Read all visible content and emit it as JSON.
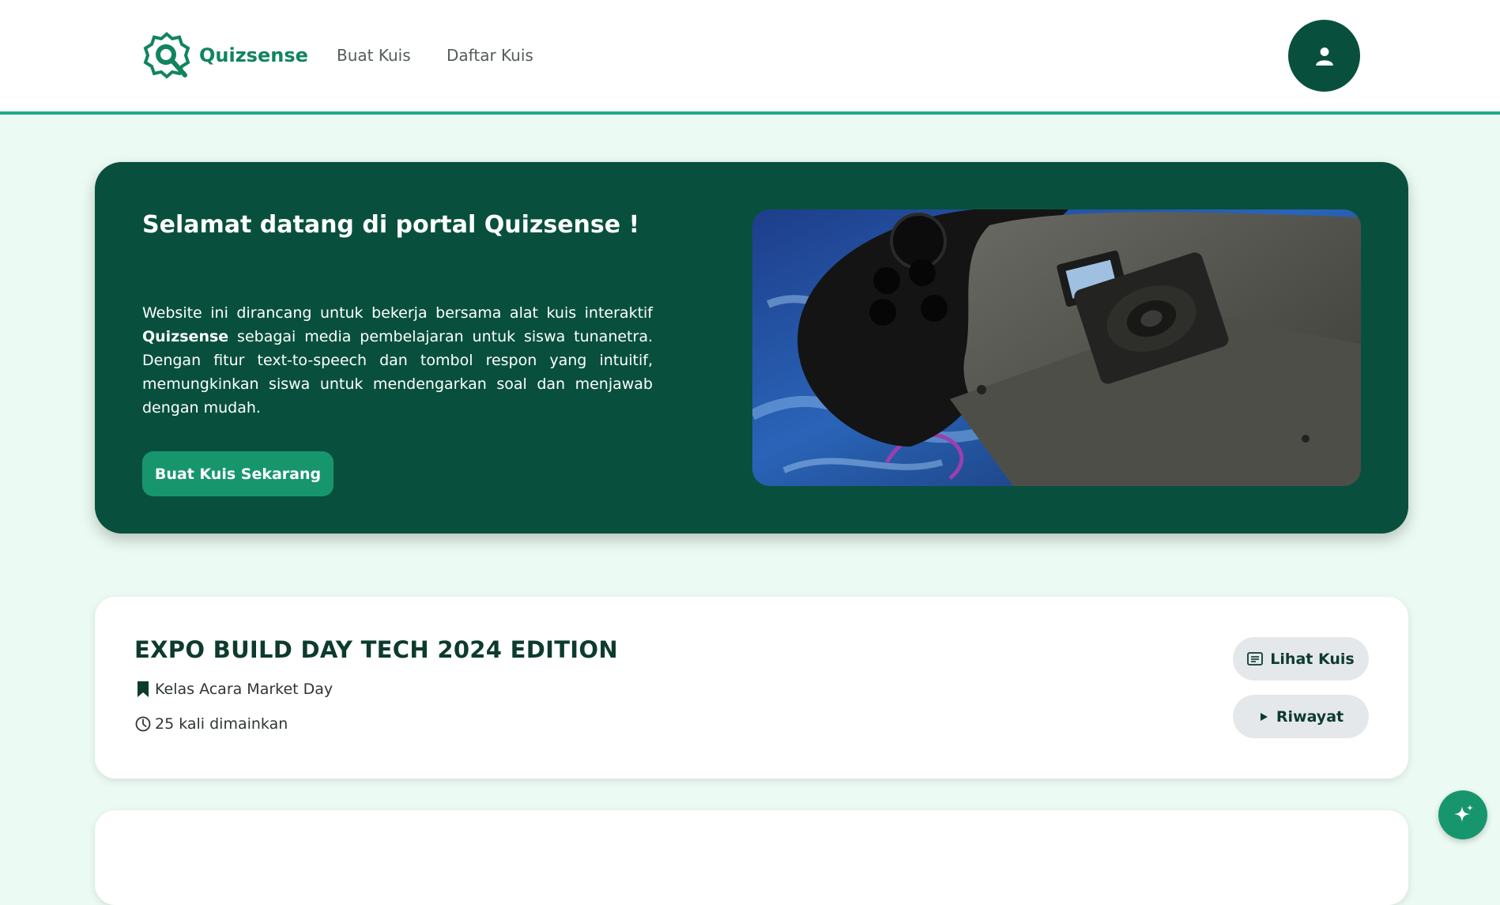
{
  "nav": {
    "brand": "Quizsense",
    "links": [
      "Buat Kuis",
      "Daftar Kuis"
    ],
    "profile_icon": "user-icon"
  },
  "hero": {
    "title": "Selamat datang di portal Quizsense !",
    "desc_before": "Website ini dirancang untuk bekerja bersama alat kuis interaktif ",
    "desc_bold": "Quizsense",
    "desc_after": " sebagai media pembelajaran untuk siswa tunanetra. Dengan fitur text-to-speech dan tombol respon yang intuitif, memungkinkan siswa untuk mendengarkan soal dan menjawab dengan mudah.",
    "cta_label": "Buat Kuis Sekarang",
    "image_subject": "gamepad controller and 3D-printed speaker box"
  },
  "quizzes": [
    {
      "title": "EXPO BUILD DAY TECH 2024 EDITION",
      "class": "Kelas Acara Market Day",
      "plays": "25 kali dimainkan",
      "view_label": "Lihat Kuis",
      "history_label": "Riwayat"
    }
  ],
  "fab_icon": "sparkle-icon",
  "colors": {
    "primary_dark": "#08503d",
    "accent": "#17966e",
    "brand": "#11845f",
    "page_bg": "#ebfaf3",
    "nav_border": "#1eae83"
  }
}
